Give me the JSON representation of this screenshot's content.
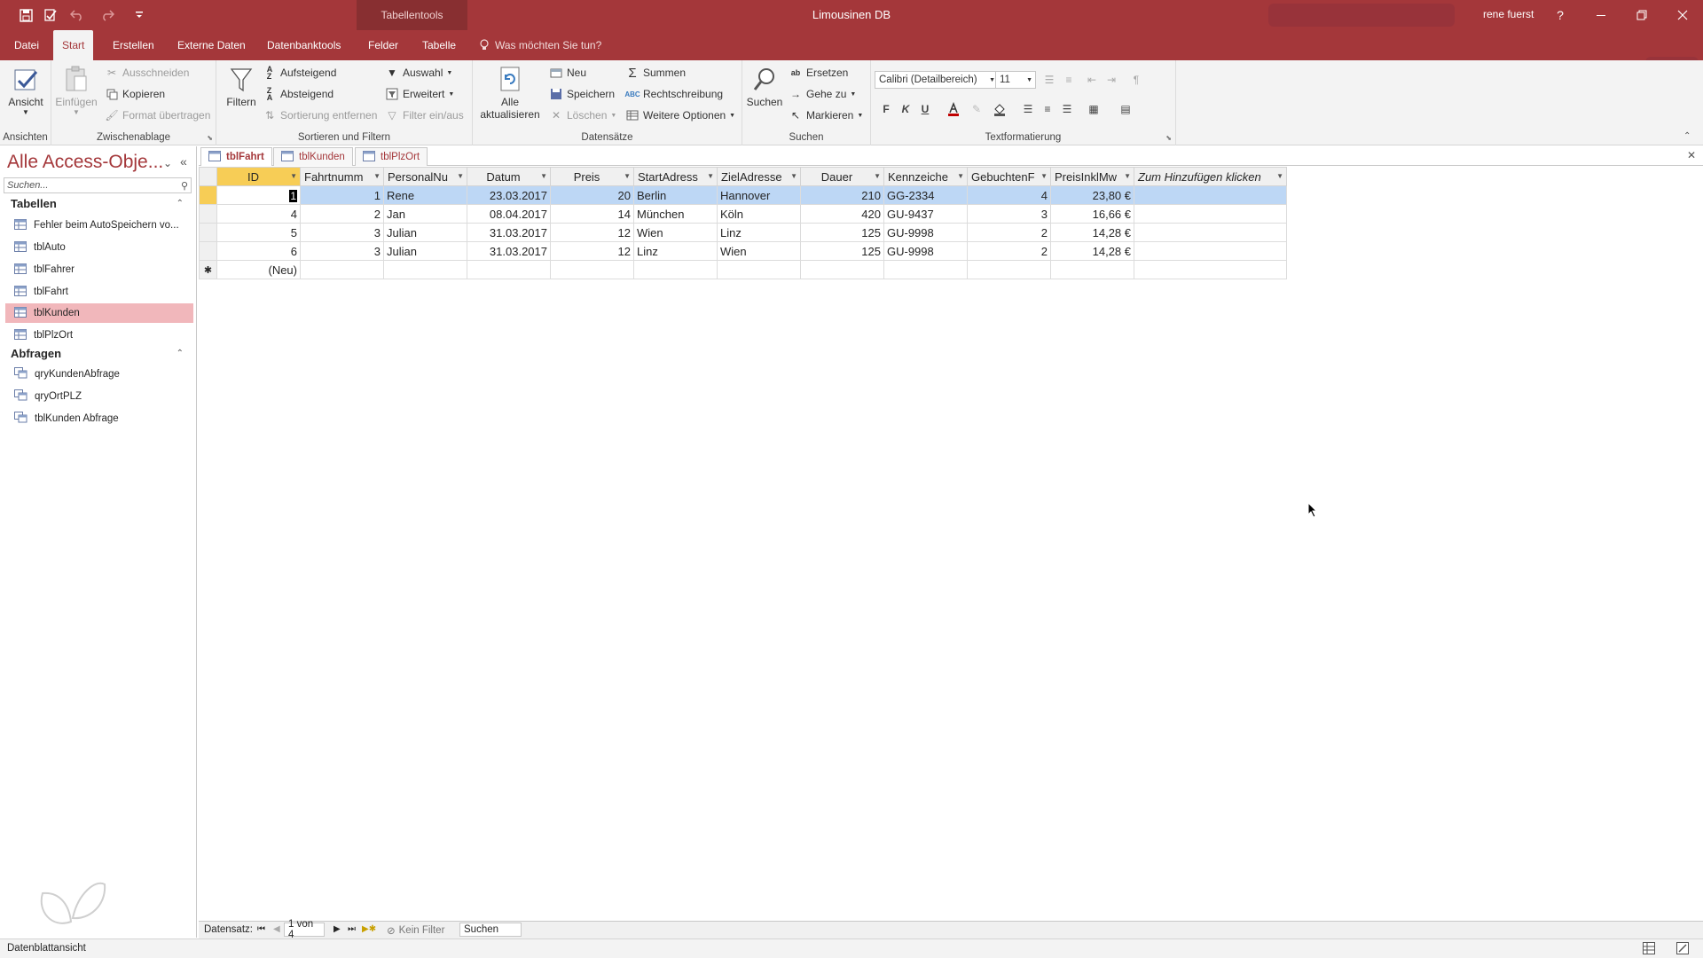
{
  "titlebar": {
    "context_tab": "Tabellentools",
    "title": "Limousinen DB",
    "user": "rene fuerst",
    "help": "?"
  },
  "menu": {
    "tabs": [
      "Datei",
      "Start",
      "Erstellen",
      "Externe Daten",
      "Datenbanktools",
      "Felder",
      "Tabelle"
    ],
    "active": "Start",
    "tellme": "Was möchten Sie tun?"
  },
  "ribbon": {
    "ansichten": {
      "label": "Ansichten",
      "ansicht": "Ansicht"
    },
    "zwischenablage": {
      "label": "Zwischenablage",
      "einfuegen": "Einfügen",
      "ausschneiden": "Ausschneiden",
      "kopieren": "Kopieren",
      "format": "Format übertragen"
    },
    "sortieren": {
      "label": "Sortieren und Filtern",
      "filtern": "Filtern",
      "aufsteigend": "Aufsteigend",
      "absteigend": "Absteigend",
      "sortierung_entfernen": "Sortierung entfernen",
      "auswahl": "Auswahl",
      "erweitert": "Erweitert",
      "filter_einaus": "Filter ein/aus"
    },
    "datensaetze": {
      "label": "Datensätze",
      "alle_1": "Alle",
      "alle_2": "aktualisieren",
      "neu": "Neu",
      "speichern": "Speichern",
      "loeschen": "Löschen",
      "summen": "Summen",
      "rechtschreibung": "Rechtschreibung",
      "weitere": "Weitere Optionen"
    },
    "suchen": {
      "label": "Suchen",
      "suchen": "Suchen",
      "ersetzen": "Ersetzen",
      "gehe_zu": "Gehe zu",
      "markieren": "Markieren"
    },
    "textformatierung": {
      "label": "Textformatierung",
      "font": "Calibri (Detailbereich)",
      "size": "11",
      "bold": "F",
      "italic": "K",
      "underline": "U"
    }
  },
  "nav": {
    "title": "Alle Access-Obje...",
    "search_placeholder": "Suchen...",
    "tables_header": "Tabellen",
    "tables": [
      "Fehler beim AutoSpeichern vo...",
      "tblAuto",
      "tblFahrer",
      "tblFahrt",
      "tblKunden",
      "tblPlzOrt"
    ],
    "selected_table": "tblKunden",
    "queries_header": "Abfragen",
    "queries": [
      "qryKundenAbfrage",
      "qryOrtPLZ",
      "tblKunden Abfrage"
    ]
  },
  "doc_tabs": [
    "tblFahrt",
    "tblKunden",
    "tblPlzOrt"
  ],
  "active_doc_tab": "tblFahrt",
  "grid": {
    "columns": [
      "ID",
      "Fahrtnumm",
      "PersonalNu",
      "Datum",
      "Preis",
      "StartAdress",
      "ZielAdresse",
      "Dauer",
      "Kennzeiche",
      "GebuchtenF",
      "PreisInklMw",
      "Zum Hinzufügen klicken"
    ],
    "rows": [
      [
        "1",
        "1",
        "Rene",
        "23.03.2017",
        "20",
        "Berlin",
        "Hannover",
        "210",
        "GG-2334",
        "4",
        "23,80 €",
        ""
      ],
      [
        "4",
        "2",
        "Jan",
        "08.04.2017",
        "14",
        "München",
        "Köln",
        "420",
        "GU-9437",
        "3",
        "16,66 €",
        ""
      ],
      [
        "5",
        "3",
        "Julian",
        "31.03.2017",
        "12",
        "Wien",
        "Linz",
        "125",
        "GU-9998",
        "2",
        "14,28 €",
        ""
      ],
      [
        "6",
        "3",
        "Julian",
        "31.03.2017",
        "12",
        "Linz",
        "Wien",
        "125",
        "GU-9998",
        "2",
        "14,28 €",
        ""
      ]
    ],
    "new_row": "(Neu)",
    "new_marker": "✱"
  },
  "recnav": {
    "label": "Datensatz:",
    "position": "1 von 4",
    "filter": "Kein Filter",
    "search": "Suchen"
  },
  "status": {
    "view": "Datenblattansicht"
  }
}
